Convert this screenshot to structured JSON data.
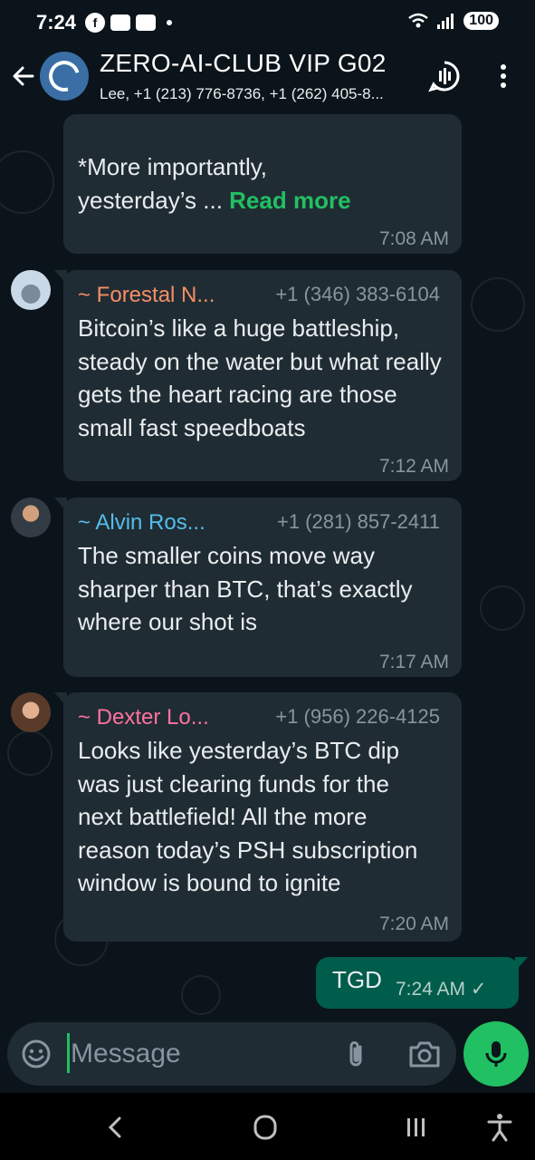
{
  "status_bar": {
    "time": "7:24",
    "battery": "100"
  },
  "header": {
    "title": "ZERO-AI-CLUB VIP G02",
    "members": "Lee, +1 (213) 776-8736, +1 (262) 405-8..."
  },
  "messages": [
    {
      "text_line1": "*More importantly,",
      "text_line2": "yesterday’s ... ",
      "read_more": "Read more",
      "time": "7:08 AM"
    },
    {
      "sender": "~ Forestal N...",
      "sender_color": "#f78e66",
      "phone": "+1 (346) 383-6104",
      "text": "Bitcoin’s like a huge battleship, steady on the water but what really gets the heart racing are those small fast speedboats",
      "time": "7:12 AM"
    },
    {
      "sender": "~ Alvin Ros...",
      "sender_color": "#53bdeb",
      "phone": "+1 (281) 857-2411",
      "text": "The smaller coins move way sharper than BTC, that’s exactly where our shot is",
      "time": "7:17 AM"
    },
    {
      "sender": "~ Dexter Lo...",
      "sender_color": "#ff72a1",
      "phone": "+1 (956) 226-4125",
      "text": "Looks like yesterday’s BTC dip was just clearing funds for the next battlefield! All the more reason today’s PSH subscription window is bound to ignite",
      "time": "7:20 AM"
    }
  ],
  "outgoing": {
    "text": "TGD",
    "time": "7:24 AM ✓"
  },
  "input": {
    "placeholder": "Message"
  },
  "icons": {
    "back": "arrow-left-icon",
    "voice_chat": "voice-chat-icon",
    "menu": "more-vertical-icon",
    "emoji": "emoji-icon",
    "attach": "paperclip-icon",
    "camera": "camera-icon",
    "mic": "mic-icon"
  },
  "colors": {
    "accent": "#21c063",
    "background": "#0b141a",
    "bubble_in": "#202c33",
    "bubble_out": "#005c4b"
  }
}
